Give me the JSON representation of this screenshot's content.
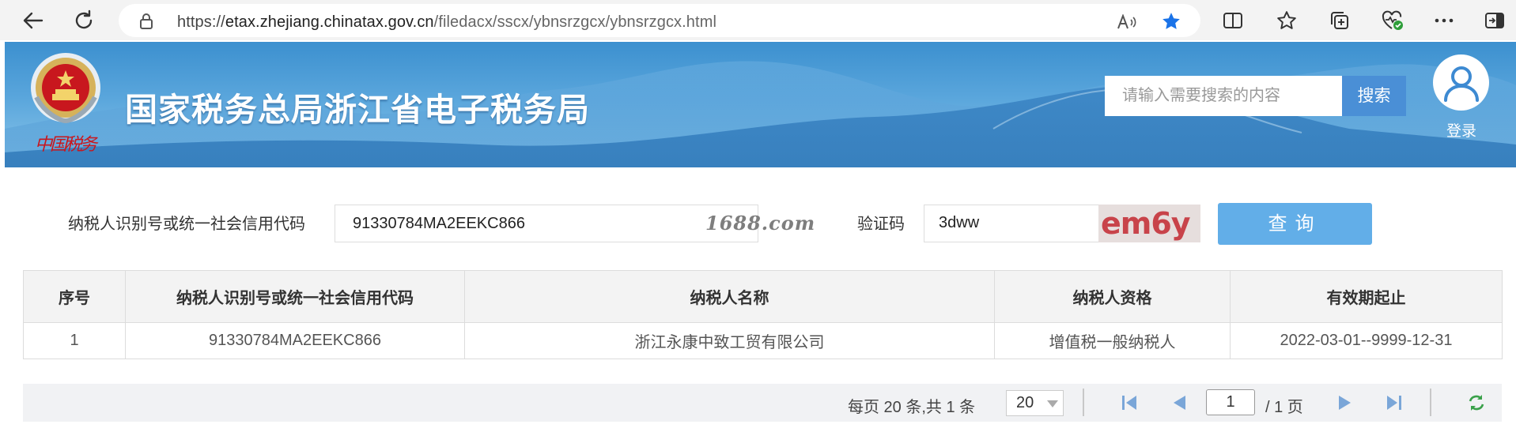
{
  "browser": {
    "url_scheme": "https://",
    "url_host": "etax.zhejiang.chinatax.gov.cn",
    "url_path": "/filedacx/sscx/ybnsrzgcx/ybnsrzgcx.html"
  },
  "header": {
    "site_title": "国家税务总局浙江省电子税务局",
    "signature": "中国税务",
    "search_placeholder": "请输入需要搜索的内容",
    "search_button": "搜索",
    "login_label": "登录"
  },
  "query": {
    "taxpayer_id_label": "纳税人识别号或统一社会信用代码",
    "taxpayer_id_value": "91330784MA2EEKC866",
    "watermark": "1688.com",
    "captcha_label": "验证码",
    "captcha_value": "3dww",
    "captcha_image_text": "em6y",
    "query_button": "查询"
  },
  "table": {
    "columns": [
      "序号",
      "纳税人识别号或统一社会信用代码",
      "纳税人名称",
      "纳税人资格",
      "有效期起止"
    ],
    "rows": [
      [
        "1",
        "91330784MA2EEKC866",
        "浙江永康中致工贸有限公司",
        "增值税一般纳税人",
        "2022-03-01--9999-12-31"
      ]
    ]
  },
  "pagination": {
    "summary": "每页 20 条,共 1 条",
    "page_size": "20",
    "current_page": "1",
    "total_pages": "/ 1 页"
  },
  "colors": {
    "banner_blue": "#3c90cf",
    "search_button": "#4a8fd6",
    "query_button": "#62aee8",
    "favorite_star": "#1a73e8"
  }
}
